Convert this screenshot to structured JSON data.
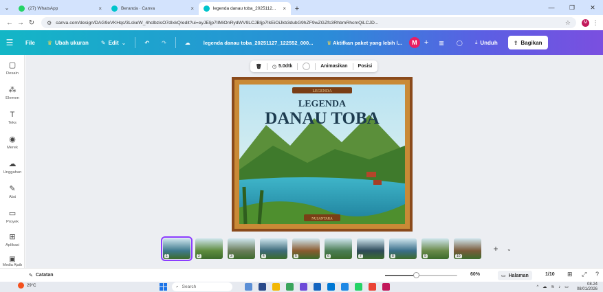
{
  "browser": {
    "tabs": [
      {
        "label": "(27) WhatsApp",
        "favicon_color": "#25d366",
        "active": false
      },
      {
        "label": "Beranda · Canva",
        "favicon_color": "#00c4cc",
        "active": false
      },
      {
        "label": "legenda danau toba_2025112...",
        "favicon_color": "#00c4cc",
        "active": true
      }
    ],
    "new_tab": "+",
    "url": "canva.com/design/DAG9eVKHqs/3LskeW_4hclbzisO7dIxkQ/edit?ui=eyJEIjp7IlMiOnRydWV9LCJBIjp7IkEiOiJkb3dubG9hZF9wZGZfc3RhbmRhcmQiLCJD...",
    "profile_initial": "M"
  },
  "toolbar": {
    "file": "File",
    "resize": "Ubah ukuran",
    "edit": "Edit",
    "doc_title": "legenda danau toba_20251127_122552_000...",
    "promo": "Aktifkan paket yang lebih l...",
    "user_initial": "M",
    "download": "Unduh",
    "share": "Bagikan"
  },
  "sidebar": {
    "items": [
      {
        "label": "Desain",
        "icon": "layout-icon",
        "glyph": "▢"
      },
      {
        "label": "Elemen",
        "icon": "elements-icon",
        "glyph": "⁂"
      },
      {
        "label": "Teks",
        "icon": "text-icon",
        "glyph": "T"
      },
      {
        "label": "Merek",
        "icon": "brand-icon",
        "glyph": "◉"
      },
      {
        "label": "Unggahan",
        "icon": "upload-icon",
        "glyph": "☁"
      },
      {
        "label": "Alat",
        "icon": "draw-icon",
        "glyph": "✎"
      },
      {
        "label": "Proyek",
        "icon": "folder-icon",
        "glyph": "▭"
      },
      {
        "label": "Aplikasi",
        "icon": "apps-icon",
        "glyph": "⊞"
      }
    ],
    "media": {
      "label": "Media Ajaib",
      "glyph": "▣"
    }
  },
  "floating_bar": {
    "duration": "5.0dtk",
    "animate": "Animasikan",
    "position": "Posisi"
  },
  "artwork": {
    "banner": "LEGENDA",
    "title_line1": "LEGENDA",
    "title_line2": "DANAU TOBA",
    "plaque": "NUSANTARA"
  },
  "filmstrip": {
    "pages": [
      "1",
      "2",
      "3",
      "4",
      "5",
      "6",
      "7",
      "8",
      "9",
      "10"
    ],
    "colors": [
      "#3f7a8e",
      "#5e8c3e",
      "#6a7d5a",
      "#3d6a7a",
      "#8a5a2e",
      "#4b7d55",
      "#2e4a5a",
      "#3a6e8a",
      "#6a8a4a",
      "#7a5a3a"
    ],
    "add": "+",
    "more": "⌄"
  },
  "footer": {
    "notes": "Catatan",
    "zoom": "60%",
    "zoom_fraction": 0.43,
    "pages": "Halaman",
    "page_count": "1/10"
  },
  "taskbar": {
    "temperature": "29°C",
    "search": "Search",
    "time": "08.24",
    "date": "08/01/2026"
  }
}
